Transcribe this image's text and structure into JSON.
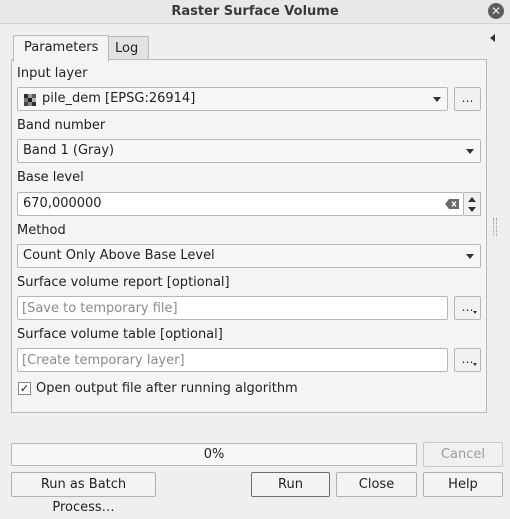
{
  "window": {
    "title": "Raster Surface Volume",
    "close_icon": "close-icon"
  },
  "tabs": [
    {
      "label": "Parameters",
      "active": true
    },
    {
      "label": "Log",
      "active": false
    }
  ],
  "parameters": {
    "input_layer": {
      "label": "Input layer",
      "value": "pile_dem [EPSG:26914]",
      "button_label": "…"
    },
    "band": {
      "label": "Band number",
      "value": "Band 1 (Gray)"
    },
    "base_level": {
      "label": "Base level",
      "value": "670,000000"
    },
    "method": {
      "label": "Method",
      "value": "Count Only Above Base Level"
    },
    "report": {
      "label": "Surface volume report [optional]",
      "placeholder": "[Save to temporary file]",
      "button_label": "…"
    },
    "table": {
      "label": "Surface volume table [optional]",
      "placeholder": "[Create temporary layer]",
      "button_label": "…"
    },
    "open_output": {
      "label": "Open output file after running algorithm",
      "checked": true,
      "check_mark": "✓"
    }
  },
  "progress": {
    "value": 0,
    "text": "0%"
  },
  "buttons": {
    "cancel": "Cancel",
    "batch": "Run as Batch Process…",
    "run": "Run",
    "close": "Close",
    "help": "Help"
  },
  "colors": {
    "background": "#efefef",
    "panel": "#f4f4f4",
    "border": "#b7b7b7",
    "disabled_text": "#9c9c9c"
  }
}
